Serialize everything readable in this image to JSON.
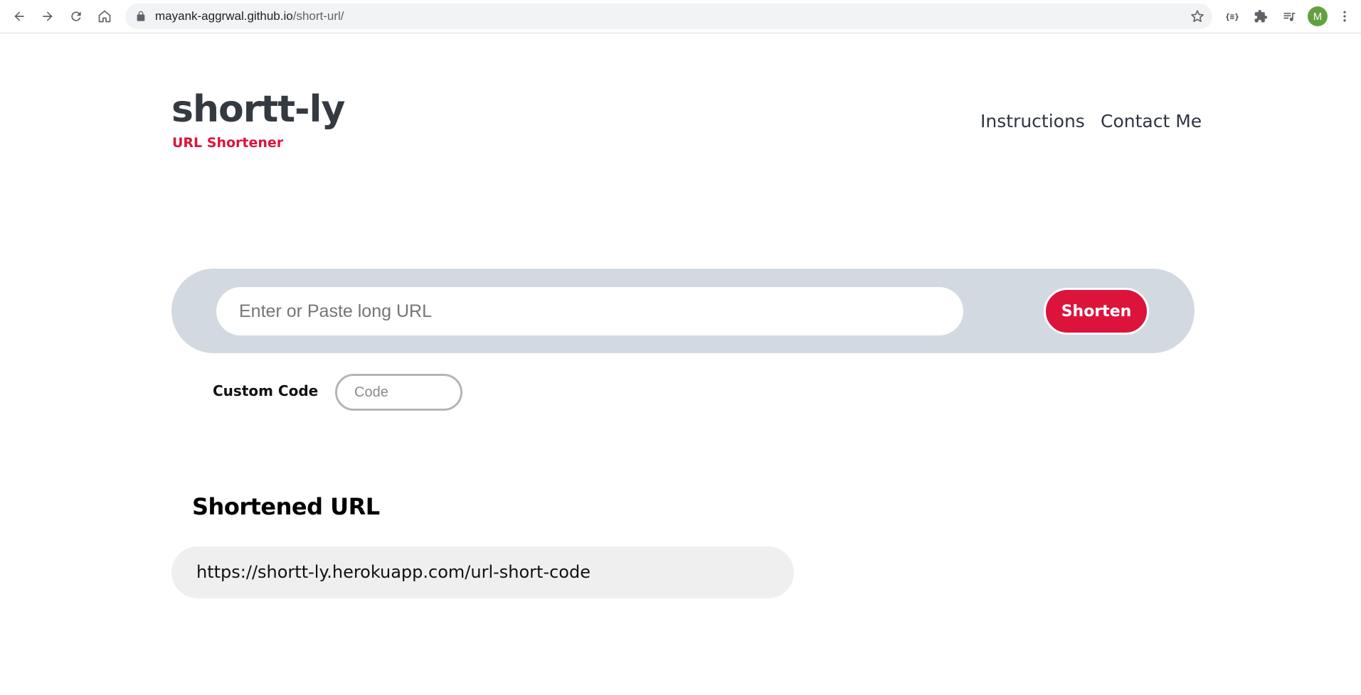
{
  "browser": {
    "url_host": "mayank-aggrwal.github.io",
    "url_path": "/short-url/",
    "extension_code_label": "{≡}",
    "avatar_letter": "M",
    "avatar_color": "#62a042"
  },
  "header": {
    "brand_title": "shortt-ly",
    "brand_subtitle": "URL Shortener",
    "nav": {
      "instructions": "Instructions",
      "contact": "Contact Me"
    }
  },
  "form": {
    "url_placeholder": "Enter or Paste long URL",
    "url_value": "",
    "shorten_label": "Shorten",
    "custom_code_label": "Custom Code",
    "code_placeholder": "Code",
    "code_value": ""
  },
  "result": {
    "heading": "Shortened URL",
    "url": "https://shortt-ly.herokuapp.com/url-short-code"
  },
  "colors": {
    "accent": "#dc143c",
    "bar_background": "#d2d9e1",
    "result_background": "#efefef",
    "text_dark": "#343a40"
  }
}
